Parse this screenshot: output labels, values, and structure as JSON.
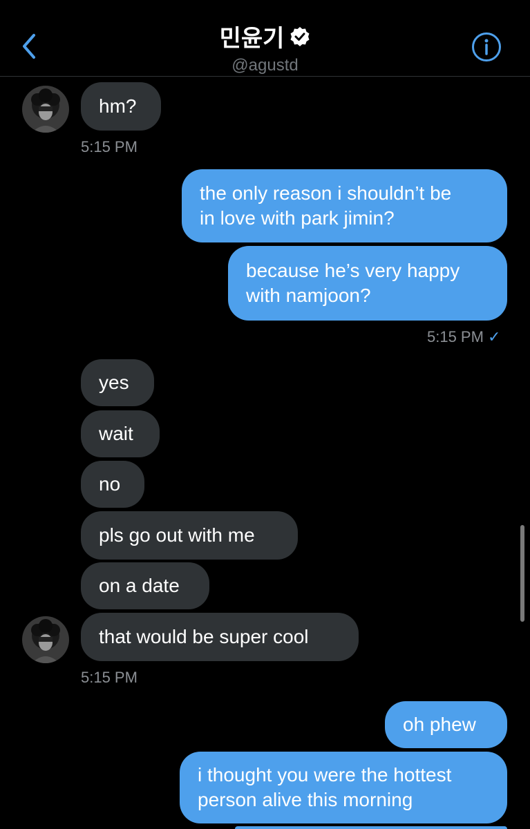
{
  "header": {
    "title": "민윤기",
    "handle": "@agustd"
  },
  "colors": {
    "accent": "#4ea0ec",
    "incoming_bubble": "#2f3336",
    "outgoing_bubble": "#4ea0ec",
    "timestamp": "#8b8f94"
  },
  "messages": {
    "in1": "hm?",
    "time1": "5:15 PM",
    "out1_line1": "the only reason i shouldn’t be",
    "out1_line2": "in love with park jimin?",
    "out2_line1": "because he’s very happy",
    "out2_line2": "with namjoon?",
    "time2": "5:15 PM",
    "read_mark": "✓",
    "in2": "yes",
    "in3": "wait",
    "in4": "no",
    "in5": "pls go out with me",
    "in6": "on a date",
    "in7": "that would be super cool",
    "time3": "5:15 PM",
    "out3": "oh phew",
    "out4_line1": "i thought you were the hottest",
    "out4_line2": "person alive this morning"
  },
  "icons": {
    "back": "chevron-left-icon",
    "verified": "verified-badge-icon",
    "info": "info-icon"
  }
}
